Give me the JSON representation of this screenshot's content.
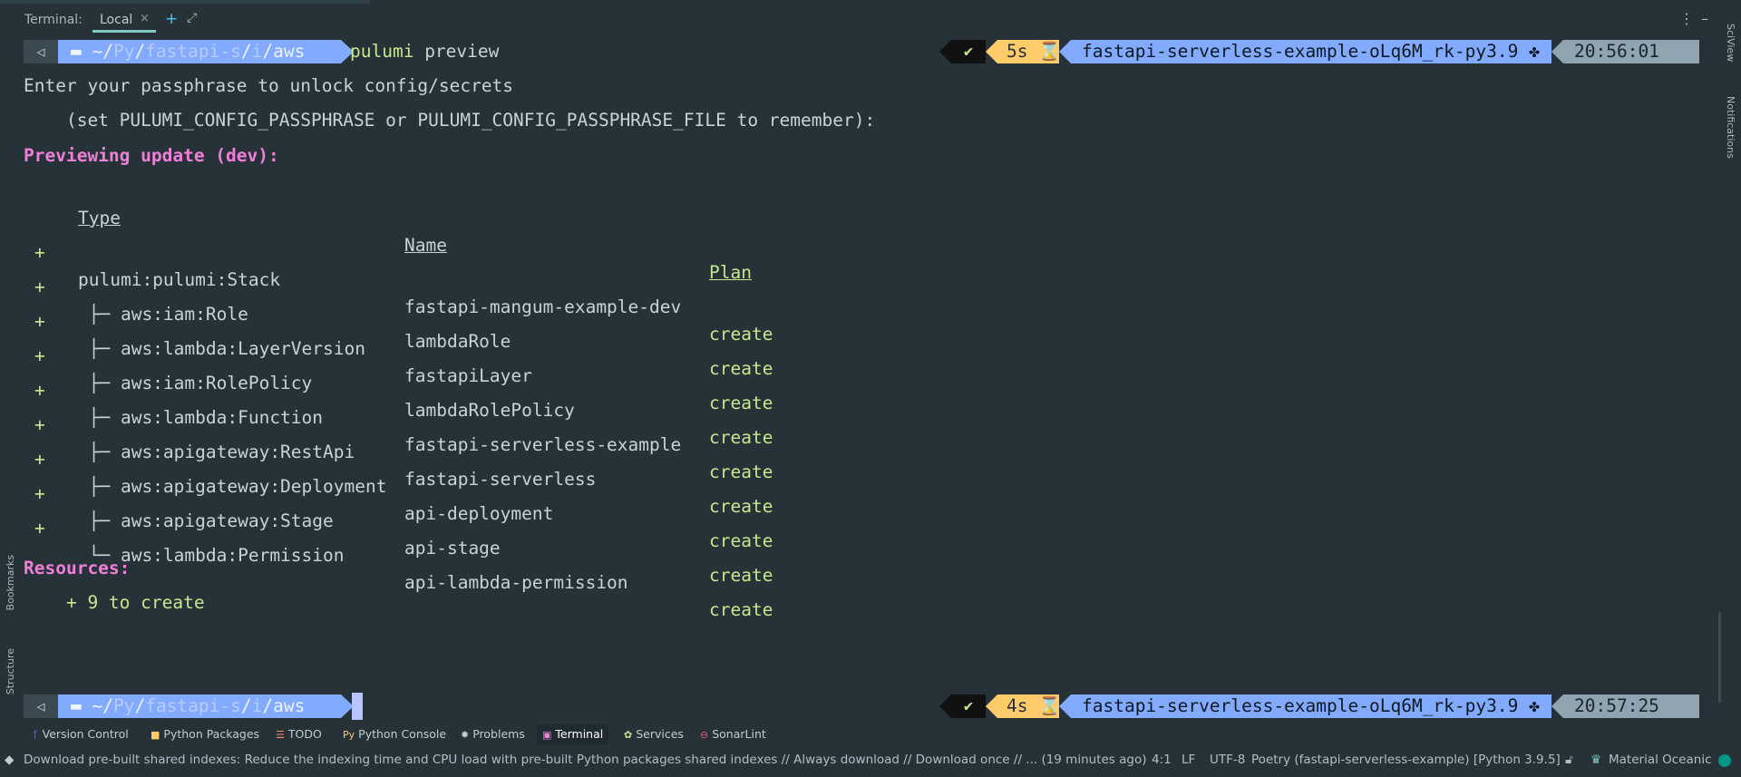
{
  "tab_header": {
    "title": "Terminal:",
    "tab_label": "Local",
    "close_glyph": "×",
    "add_glyph": "+",
    "expand_glyph": "⤢",
    "options_glyph": "⋮",
    "minimize_glyph": "–"
  },
  "side_panels": {
    "right": [
      "SciView",
      "Notifications"
    ],
    "left": [
      "Bookmarks",
      "Structure"
    ]
  },
  "prompt_top": {
    "path_home": "~/",
    "path_py": "Py",
    "path_proj": "fastapi-s",
    "path_i": "i",
    "path_aws": "aws",
    "command_bin": "pulumi",
    "command_arg": " preview",
    "status_check": "✔",
    "duration": "5s ⌛",
    "venv": "fastapi-serverless-example-oLq6M_rk-py3.9 ✤",
    "time": "20:56:01"
  },
  "output": {
    "line1": "Enter your passphrase to unlock config/secrets",
    "line2": "    (set PULUMI_CONFIG_PASSPHRASE or PULUMI_CONFIG_PASSPHRASE_FILE to remember):",
    "previewing": "Previewing update (dev):",
    "headers": {
      "type": "Type",
      "name": "Name",
      "plan": "Plan"
    },
    "rows": [
      {
        "sign": "+",
        "type": "pulumi:pulumi:Stack",
        "name": "fastapi-mangum-example-dev",
        "plan": "create"
      },
      {
        "sign": "+",
        "type": " ├─ aws:iam:Role",
        "name": "lambdaRole",
        "plan": "create"
      },
      {
        "sign": "+",
        "type": " ├─ aws:lambda:LayerVersion",
        "name": "fastapiLayer",
        "plan": "create"
      },
      {
        "sign": "+",
        "type": " ├─ aws:iam:RolePolicy",
        "name": "lambdaRolePolicy",
        "plan": "create"
      },
      {
        "sign": "+",
        "type": " ├─ aws:lambda:Function",
        "name": "fastapi-serverless-example",
        "plan": "create"
      },
      {
        "sign": "+",
        "type": " ├─ aws:apigateway:RestApi",
        "name": "fastapi-serverless",
        "plan": "create"
      },
      {
        "sign": "+",
        "type": " ├─ aws:apigateway:Deployment",
        "name": "api-deployment",
        "plan": "create"
      },
      {
        "sign": "+",
        "type": " ├─ aws:apigateway:Stage",
        "name": "api-stage",
        "plan": "create"
      },
      {
        "sign": "+",
        "type": " └─ aws:lambda:Permission",
        "name": "api-lambda-permission",
        "plan": "create"
      }
    ],
    "resources_label": "Resources:",
    "resources_summary": "    + 9 to create"
  },
  "prompt_bottom": {
    "path_home": "~/",
    "path_py": "Py",
    "path_proj": "fastapi-s",
    "path_i": "i",
    "path_aws": "aws",
    "status_check": "✔",
    "duration": "4s ⌛",
    "venv": "fastapi-serverless-example-oLq6M_rk-py3.9 ✤",
    "time": "20:57:25"
  },
  "tool_windows": [
    {
      "label": "Version Control",
      "icon": "branch-icon"
    },
    {
      "label": "Python Packages",
      "icon": "package-icon"
    },
    {
      "label": "TODO",
      "icon": "todo-icon"
    },
    {
      "label": "Python Console",
      "icon": "python-icon"
    },
    {
      "label": "Problems",
      "icon": "bug-icon"
    },
    {
      "label": "Terminal",
      "icon": "terminal-icon",
      "active": true
    },
    {
      "label": "Services",
      "icon": "services-icon"
    },
    {
      "label": "SonarLint",
      "icon": "sonarlint-icon"
    }
  ],
  "status_bar": {
    "message": "Download pre-built shared indexes: Reduce the indexing time and CPU load with pre-built Python packages shared indexes // Always download // Download once // ... (19 minutes ago)",
    "position": "4:1",
    "line_sep": "LF",
    "encoding": "UTF-8",
    "interpreter": "Poetry (fastapi-serverless-example) [Python 3.9.5]",
    "theme": "Material Oceanic"
  },
  "colors": {
    "background": "#263238",
    "accent_green": "#c3e88d",
    "accent_pink": "#f07fda",
    "accent_blue": "#82aaff",
    "accent_yellow": "#ffcb6b",
    "link_blue": "#4fb8f0"
  }
}
